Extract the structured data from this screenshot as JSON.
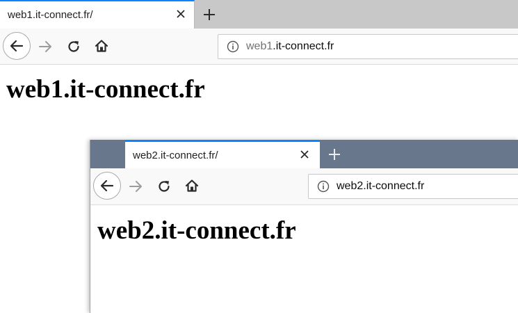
{
  "colors": {
    "accent": "#0a84ff",
    "tabstrip_window1": "#c8c8c8",
    "tabstrip_window2": "#68778b"
  },
  "window1": {
    "tab_title": "web1.it-connect.fr/",
    "url_prefix": "web1",
    "url_rest": ".it-connect.fr",
    "heading": "web1.it-connect.fr"
  },
  "window2": {
    "tab_title": "web2.it-connect.fr/",
    "url_prefix": "web2",
    "url_rest": ".it-connect.fr",
    "heading": "web2.it-connect.fr"
  },
  "icons": {
    "close": "close-icon",
    "new_tab": "plus-icon",
    "back": "arrow-left-icon",
    "forward": "arrow-right-icon",
    "reload": "reload-icon",
    "home": "home-icon",
    "site_info": "info-icon"
  }
}
